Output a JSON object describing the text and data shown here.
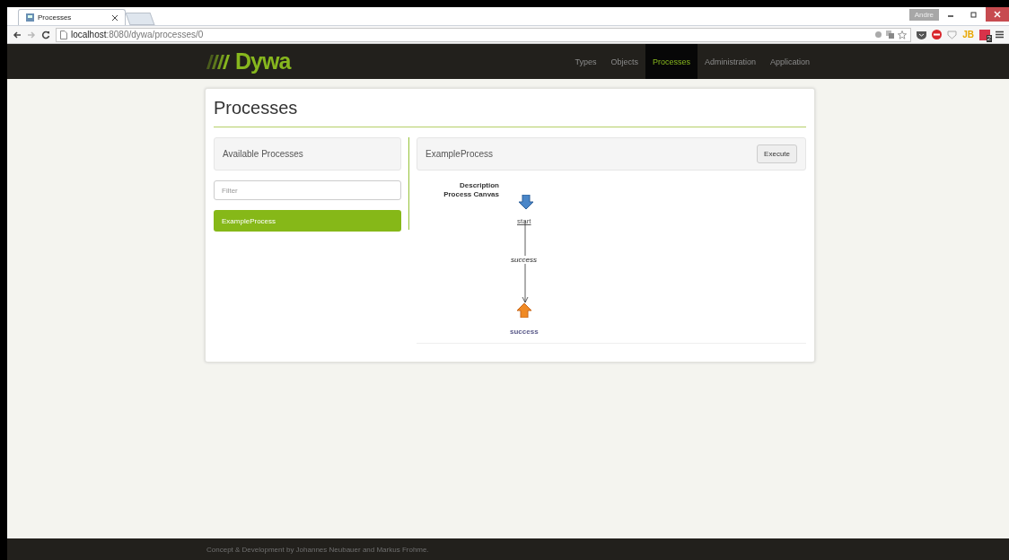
{
  "browser": {
    "tabs": [
      {
        "title": "Processes",
        "selected": true
      }
    ],
    "url_host": "localhost",
    "url_path": ":8080/dywa/processes/0",
    "user": "Andre",
    "extension_label": "JB",
    "extension_badge": "2"
  },
  "navbar": {
    "logo": "Dywa",
    "items": [
      {
        "label": "Types",
        "selected": false
      },
      {
        "label": "Objects",
        "selected": false
      },
      {
        "label": "Processes",
        "selected": true
      },
      {
        "label": "Administration",
        "selected": false
      },
      {
        "label": "Application",
        "selected": false
      }
    ]
  },
  "page": {
    "title": "Processes",
    "sidebar": {
      "heading": "Available Processes",
      "filter": {
        "placeholder": "Filter"
      },
      "items": [
        {
          "label": "ExampleProcess",
          "selected": true
        }
      ]
    },
    "detail": {
      "title": "ExampleProcess",
      "button": "Execute",
      "labels": [
        "Description",
        "Process Canvas"
      ],
      "diagram": {
        "start": "start",
        "edge": "success",
        "end": "success"
      }
    }
  },
  "footer": "Concept & Development by Johannes Neubauer and Markus Frohme."
}
